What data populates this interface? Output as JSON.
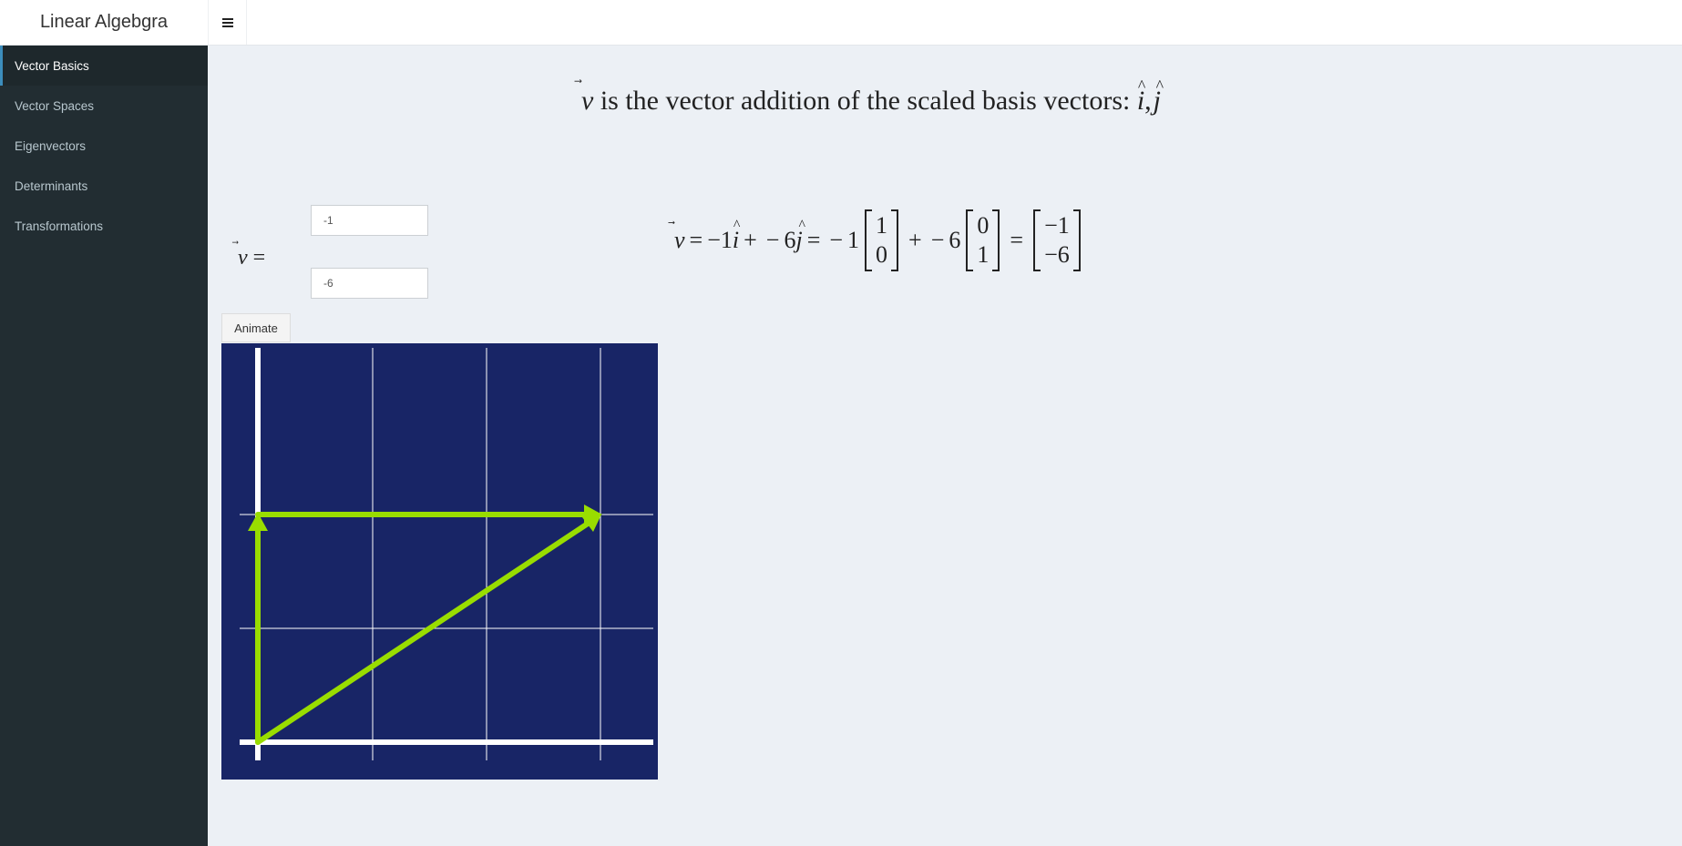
{
  "app": {
    "title": "Linear Algebgra",
    "menu_icon": "hamburger-icon"
  },
  "sidebar": {
    "items": [
      {
        "label": "Vector Basics",
        "active": true
      },
      {
        "label": "Vector Spaces",
        "active": false
      },
      {
        "label": "Eigenvectors",
        "active": false
      },
      {
        "label": "Determinants",
        "active": false
      },
      {
        "label": "Transformations",
        "active": false
      }
    ]
  },
  "main": {
    "title_rest": "is the vector addition of the scaled basis vectors:",
    "vector_symbol": "v",
    "basis_i": "i",
    "basis_j": "j",
    "inputs": {
      "x_value": "-1",
      "y_value": "-6"
    },
    "animate_label": "Animate",
    "equation": {
      "scalar_x": "−1",
      "scalar_y": "6",
      "basis_i_matrix": [
        "1",
        "0"
      ],
      "basis_j_matrix": [
        "0",
        "1"
      ],
      "result_matrix": [
        "−1",
        "−6"
      ]
    }
  },
  "colors": {
    "plot_background": "#182566",
    "vector_color": "#99dd00",
    "axis_color": "#ffffff"
  }
}
